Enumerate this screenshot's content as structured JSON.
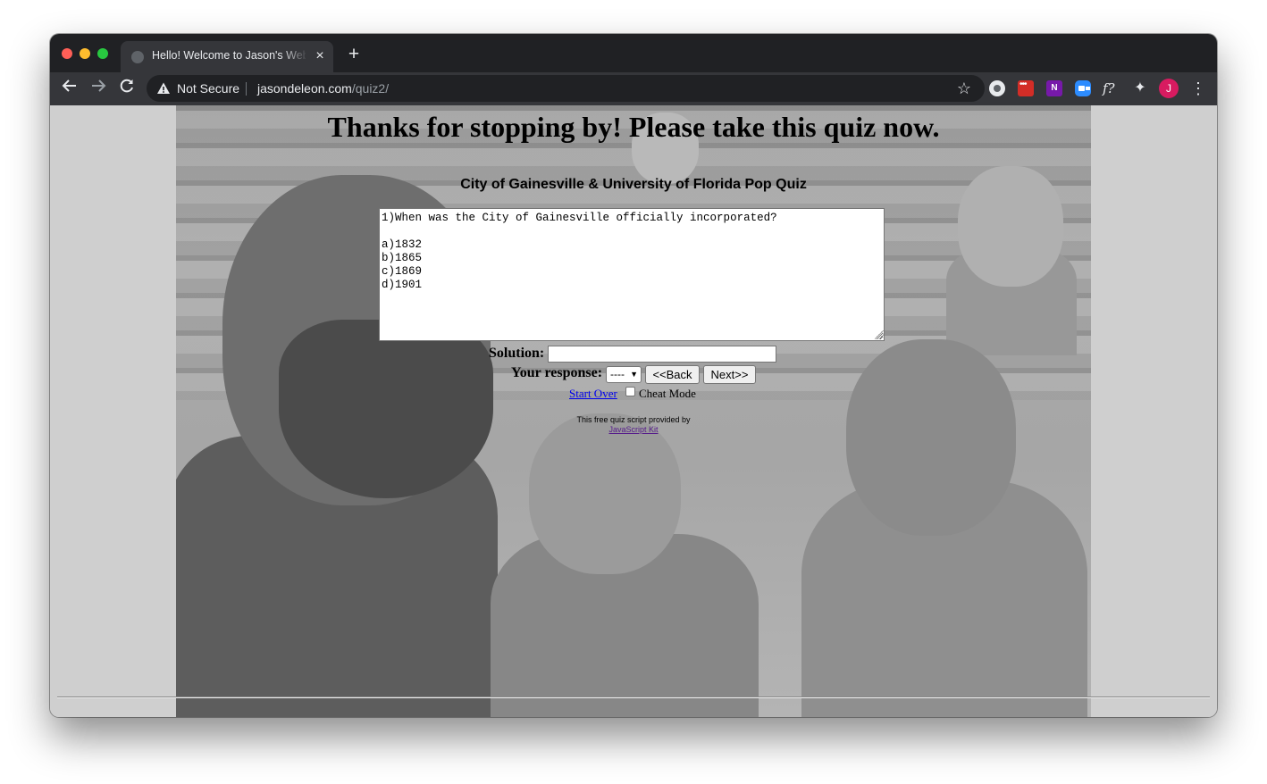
{
  "browser": {
    "tab_title": "Hello! Welcome to Jason's Web",
    "tab_close": "×",
    "new_tab": "+",
    "security_label": "Not Secure",
    "url_host": "jasondeleon.com",
    "url_path": "/quiz2/",
    "profile_initial": "J",
    "extensions": [
      "recorder-icon",
      "lastpass-icon",
      "onenote-icon",
      "zoom-icon",
      "f-extension-icon",
      "puzzle-icon"
    ],
    "onenote_label": "N",
    "f_label": "f?"
  },
  "page": {
    "heading": "Thanks for stopping by! Please take this quiz now.",
    "quiz_title": "City of Gainesville & University of Florida Pop Quiz",
    "question_text": "1)When was the City of Gainesville officially incorporated?\n\na)1832\nb)1865\nc)1869\nd)1901",
    "solution_label": "Solution:",
    "solution_value": "",
    "response_label": "Your response:",
    "response_selected": "----",
    "back_label": "<<Back",
    "next_label": "Next>>",
    "start_over_label": "Start Over",
    "cheat_mode_label": "Cheat Mode",
    "cheat_mode_checked": false,
    "credit_text": "This free quiz script provided by",
    "credit_link": "JavaScript Kit"
  },
  "colors": {
    "chrome_dark": "#202124",
    "chrome_toolbar": "#35363a",
    "page_bg": "#cfcfcf",
    "link": "#0000ee",
    "visited_link": "#551a8b"
  }
}
